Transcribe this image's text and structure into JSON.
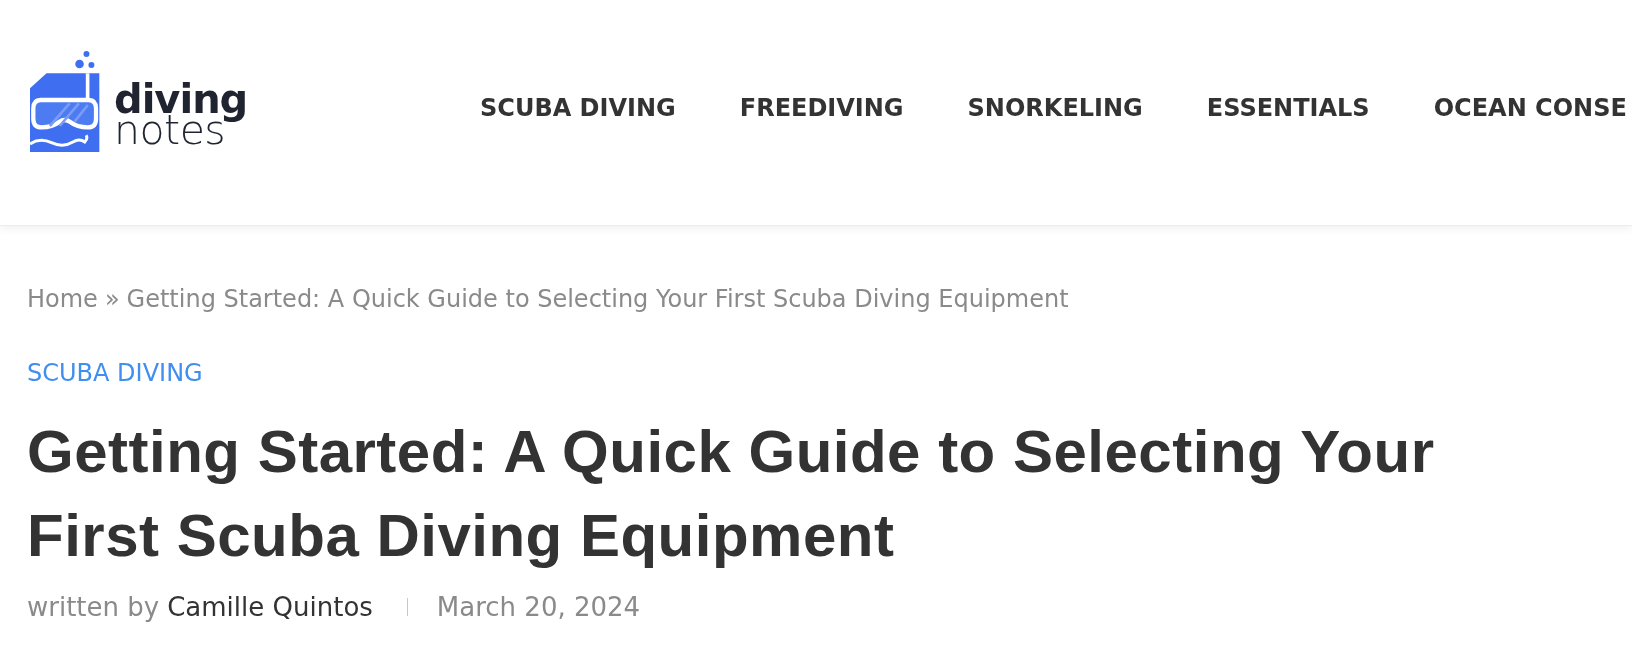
{
  "header": {
    "logo": {
      "top_word": "diving",
      "bottom_word": "notes"
    },
    "nav": [
      {
        "label": "SCUBA DIVING"
      },
      {
        "label": "FREEDIVING"
      },
      {
        "label": "SNORKELING"
      },
      {
        "label": "ESSENTIALS"
      },
      {
        "label": "OCEAN CONSE"
      }
    ]
  },
  "breadcrumb": {
    "home": "Home",
    "separator": "»",
    "current": "Getting Started: A Quick Guide to Selecting Your First Scuba Diving Equipment"
  },
  "category": "SCUBA DIVING",
  "title": "Getting Started: A Quick Guide to Selecting Your First Scuba Diving Equipment",
  "byline": {
    "prefix": "written by",
    "author": "Camille Quintos",
    "date": "March 20, 2024"
  }
}
